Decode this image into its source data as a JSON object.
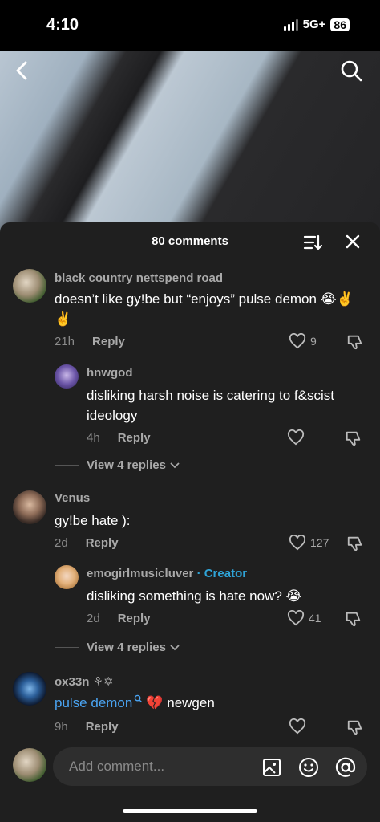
{
  "status": {
    "time": "4:10",
    "network": "5G+",
    "battery": "86"
  },
  "header": {
    "comment_count": "80 comments"
  },
  "comments": [
    {
      "username": "black country nettspend  road",
      "text": "doesn’t like gy!be but “enjoys” pulse demon 😭✌️✌️",
      "time": "21h",
      "reply": "Reply",
      "likes": "9"
    },
    {
      "username": "hnwgod",
      "text": "disliking harsh noise is catering to f&scist ideology",
      "time": "4h",
      "reply": "Reply",
      "likes": ""
    },
    {
      "view_replies": "View 4 replies"
    },
    {
      "username": "Venus",
      "text": "gy!be hate ):",
      "time": "2d",
      "reply": "Reply",
      "likes": "127"
    },
    {
      "username": "emogirlmusicluver",
      "badge": "· Creator",
      "text": "disliking something is hate now? 😭",
      "time": "2d",
      "reply": "Reply",
      "likes": "41"
    },
    {
      "view_replies": "View 4 replies"
    },
    {
      "username": "ox33n ⚘✡",
      "link_text": "pulse demon",
      "text_rest": "💔  newgen",
      "time": "9h",
      "reply": "Reply",
      "likes": ""
    }
  ],
  "composer": {
    "placeholder": "Add comment..."
  }
}
